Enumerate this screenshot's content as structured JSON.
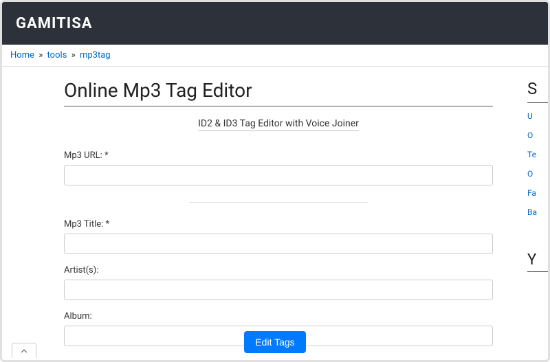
{
  "header": {
    "brand": "GAMITISA"
  },
  "breadcrumb": {
    "home": "Home",
    "tools": "tools",
    "mp3tag": "mp3tag",
    "sep": "»"
  },
  "main": {
    "title": "Online Mp3 Tag Editor",
    "subtitle": "ID2 & ID3 Tag Editor with Voice Joiner",
    "labels": {
      "url": "Mp3 URL: *",
      "title": "Mp3 Title: *",
      "artist": "Artist(s):",
      "album": "Album:"
    },
    "values": {
      "url": "",
      "title": "",
      "artist": "",
      "album": ""
    },
    "button": "Edit Tags"
  },
  "sidebar": {
    "head1": "S",
    "links": [
      "U",
      "O",
      "Te",
      "O",
      "Fa",
      "Ba"
    ],
    "head2": "Y"
  }
}
